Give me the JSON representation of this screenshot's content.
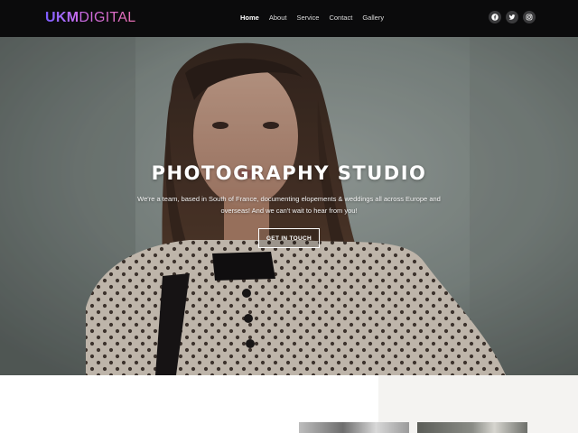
{
  "header": {
    "logo_bold": "UKM",
    "logo_light": "DIGITAL",
    "nav": [
      "Home",
      "About",
      "Service",
      "Contact",
      "Gallery"
    ],
    "active_nav": "Home",
    "social_icons": [
      "facebook-icon",
      "twitter-icon",
      "instagram-icon"
    ]
  },
  "hero": {
    "title": "PHOTOGRAPHY STUDIO",
    "text": "We're a team, based in South of France, documenting elopements & weddings all across Europe and overseas! And we can't wait to hear from you!",
    "button_label": "GET IN TOUCH"
  },
  "colors": {
    "header_bg": "#0b0b0c",
    "logo_gradient": [
      "#7b5cff",
      "#e86fb0"
    ],
    "hero_text": "#ffffff",
    "lower_panel": "#f4f3f1"
  }
}
